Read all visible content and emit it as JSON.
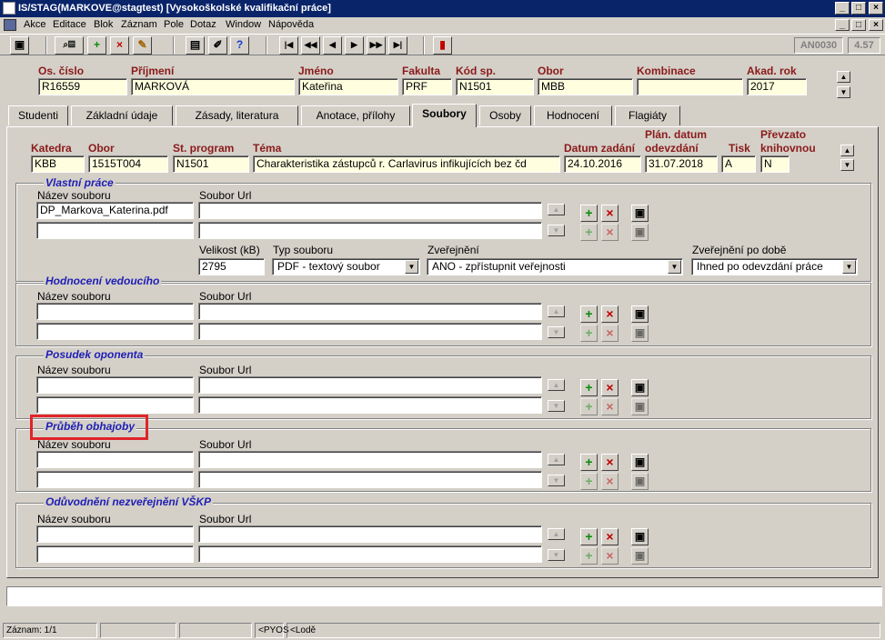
{
  "window": {
    "title": "IS/STAG(MARKOVE@stagtest)  [Vysokoškolské kvalifikační práce]"
  },
  "menu": [
    "Akce",
    "Editace",
    "Blok",
    "Záznam",
    "Pole",
    "Dotaz",
    "Window",
    "Nápověda"
  ],
  "toolbar": {
    "code1": "AN0030",
    "code2": "4.57"
  },
  "header": {
    "labels": {
      "os_cislo": "Os. číslo",
      "prijmeni": "Příjmení",
      "jmeno": "Jméno",
      "fakulta": "Fakulta",
      "kod_sp": "Kód sp.",
      "obor": "Obor",
      "kombinace": "Kombinace",
      "akad_rok": "Akad. rok"
    },
    "values": {
      "os_cislo": "R16559",
      "prijmeni": "MARKOVÁ",
      "jmeno": "Kateřina",
      "fakulta": "PRF",
      "kod_sp": "N1501",
      "obor": "MBB",
      "kombinace": "",
      "akad_rok": "2017"
    }
  },
  "tabs": [
    "Studenti",
    "Základní údaje",
    "Zásady, literatura",
    "Anotace, přílohy",
    "Soubory",
    "Osoby",
    "Hodnocení",
    "Flagiáty"
  ],
  "active_tab": "Soubory",
  "thesis": {
    "labels": {
      "katedra": "Katedra",
      "obor": "Obor",
      "st_program": "St. program",
      "tema": "Téma",
      "datum_zadani": "Datum zadání",
      "plan_datum_1": "Plán. datum",
      "plan_datum_2": "odevzdání",
      "tisk": "Tisk",
      "prevzato_1": "Převzato",
      "prevzato_2": "knihovnou"
    },
    "values": {
      "katedra": "KBB",
      "obor": "1515T004",
      "st_program": "N1501",
      "tema": "Charakteristika zástupců r. Carlavirus infikujících bez čd",
      "datum_zadani": "24.10.2016",
      "plan_datum": "31.07.2018",
      "tisk": "A",
      "prevzato": "N"
    }
  },
  "common": {
    "nazev_souboru": "Název souboru",
    "soubor_url": "Soubor Url"
  },
  "groups": {
    "vlastni": {
      "title": "Vlastní práce",
      "file1": "DP_Markova_Katerina.pdf",
      "velikost_label": "Velikost (kB)",
      "velikost_value": "2795",
      "typ_label": "Typ souboru",
      "typ_value": "PDF - textový soubor",
      "zverejneni_label": "Zveřejnění",
      "zverejneni_value": "ANO - zpřístupnit veřejnosti",
      "zverejneni_po_label": "Zveřejnění po době",
      "zverejneni_po_value": "Ihned po odevzdání práce"
    },
    "hodnoceni": {
      "title": "Hodnocení vedoucího"
    },
    "posudek": {
      "title": "Posudek oponenta"
    },
    "prubeh": {
      "title": "Průběh obhajoby"
    },
    "oduvodneni": {
      "title": "Odůvodnění nezveřejnění VŠKP"
    }
  },
  "status": {
    "zaznam": "Záznam: 1/1",
    "pyos": "<PYOS",
    "lode": "<Lodě"
  }
}
